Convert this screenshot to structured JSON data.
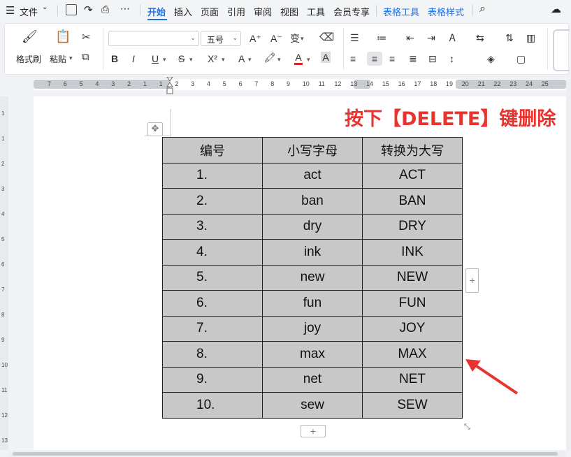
{
  "menubar": {
    "file_label": "文件",
    "tabs": [
      "开始",
      "插入",
      "页面",
      "引用",
      "审阅",
      "视图",
      "工具",
      "会员专享"
    ],
    "context_tabs": [
      "表格工具",
      "表格样式"
    ]
  },
  "ribbon": {
    "format_painter": "格式刷",
    "paste": "粘贴",
    "font_name": "",
    "font_size": "五号",
    "bold": "B",
    "italic": "I",
    "underline": "U",
    "strikethrough": "S",
    "superscript": "X²",
    "font_color_label": "A",
    "highlight_label": "A",
    "char_shading": "A",
    "grow_font": "A⁺",
    "shrink_font": "A⁻",
    "phonetic": "变"
  },
  "ruler": {
    "numbers": [
      "7",
      "6",
      "5",
      "4",
      "3",
      "2",
      "1",
      "1",
      "2",
      "3",
      "4",
      "5",
      "6",
      "7",
      "8",
      "9",
      "10",
      "11",
      "12",
      "13",
      "14",
      "15",
      "16",
      "17",
      "18",
      "19",
      "20",
      "21",
      "22",
      "23",
      "24",
      "25"
    ]
  },
  "vruler": {
    "numbers": [
      "1",
      "1",
      "2",
      "3",
      "4",
      "5",
      "6",
      "7",
      "8",
      "9",
      "10",
      "11",
      "12",
      "13"
    ]
  },
  "annotation": "按下【DELETE】键删除",
  "table": {
    "headers": [
      "编号",
      "小写字母",
      "转换为大写"
    ],
    "rows": [
      [
        "1.",
        "act",
        "ACT"
      ],
      [
        "2.",
        "ban",
        "BAN"
      ],
      [
        "3.",
        "dry",
        "DRY"
      ],
      [
        "4.",
        "ink",
        "INK"
      ],
      [
        "5.",
        "new",
        "NEW"
      ],
      [
        "6.",
        "fun",
        "FUN"
      ],
      [
        "7.",
        "joy",
        "JOY"
      ],
      [
        "8.",
        "max",
        "MAX"
      ],
      [
        "9.",
        "net",
        "NET"
      ],
      [
        "10.",
        "sew",
        "SEW"
      ]
    ]
  },
  "colors": {
    "accent": "#1f6fe0",
    "annotation": "#e8332f",
    "table_fill": "#c8c8c8"
  }
}
